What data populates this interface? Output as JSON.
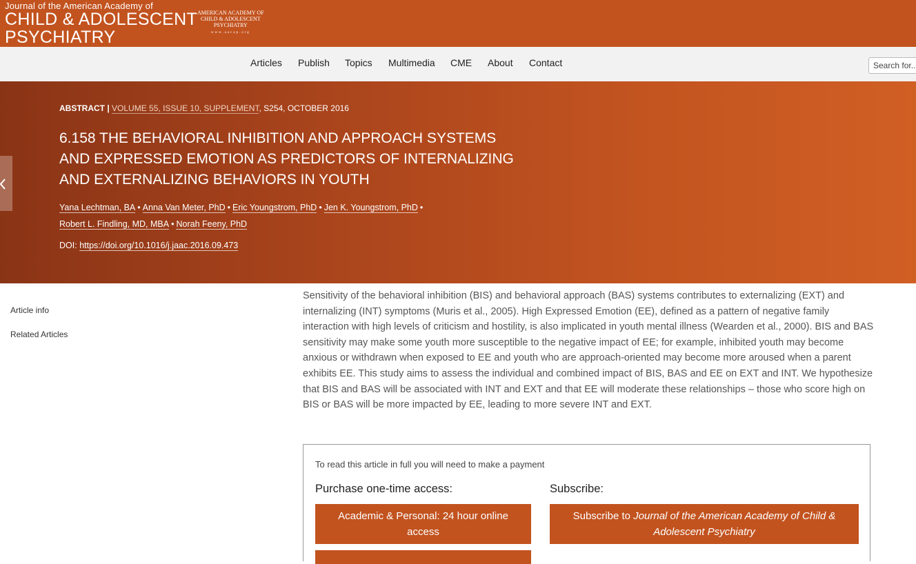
{
  "header": {
    "brand_line1": "Journal of the American Academy of",
    "brand_line2": "CHILD & ADOLESCENT",
    "brand_line3": "PSYCHIATRY",
    "seal_line1": "AMERICAN ACADEMY OF",
    "seal_line2": "CHILD & ADOLESCENT",
    "seal_line3": "PSYCHIATRY",
    "seal_line4": "www.aacap.org"
  },
  "nav": {
    "items": [
      "Articles",
      "Publish",
      "Topics",
      "Multimedia",
      "CME",
      "About",
      "Contact"
    ],
    "search_placeholder": "Search for..."
  },
  "article": {
    "type": "ABSTRACT",
    "separator": "|",
    "volume": "VOLUME 55, ISSUE 10, SUPPLEMENT",
    "pages_date": ", S254, OCTOBER 2016",
    "title": "6.158 THE BEHAVIORAL INHIBITION AND APPROACH SYSTEMS AND EXPRESSED EMOTION AS PREDICTORS OF INTERNALIZING AND EXTERNALIZING BEHAVIORS IN YOUTH",
    "authors": [
      "Yana Lechtman, BA",
      "Anna Van Meter, PhD",
      "Eric Youngstrom, PhD",
      "Jen K. Youngstrom, PhD",
      "Robert L. Findling, MD, MBA",
      "Norah Feeny, PhD"
    ],
    "author_sep": "•",
    "doi_label": "DOI:",
    "doi": "https://doi.org/10.1016/j.jaac.2016.09.473",
    "abstract": "Sensitivity of the behavioral inhibition (BIS) and behavioral approach (BAS) systems contributes to externalizing (EXT) and internalizing (INT) symptoms (Muris et al., 2005). High Expressed Emotion (EE), defined as a pattern of negative family interaction with high levels of criticism and hostility, is also implicated in youth mental illness (Wearden et al., 2000). BIS and BAS sensitivity may make some youth more susceptible to the negative impact of EE; for example, inhibited youth may become anxious or withdrawn when exposed to EE and youth who are approach-oriented may become more aroused when a parent exhibits EE. This study aims to assess the individual and combined impact of BIS, BAS and EE on EXT and INT. We hypothesize that BIS and BAS will be associated with INT and EXT and that EE will moderate these relationships – those who score high on BIS or BAS will be more impacted by EE, leading to more severe INT and EXT."
  },
  "sidebar": {
    "items": [
      "Article info",
      "Related Articles"
    ]
  },
  "paywall": {
    "note": "To read this article in full you will need to make a payment",
    "purchase_heading": "Purchase one-time access:",
    "subscribe_heading": "Subscribe:",
    "purchase_button": "Academic & Personal: 24 hour online access",
    "subscribe_prefix": "Subscribe to",
    "subscribe_journal": "Journal of the American Academy of Child & Adolescent Psychiatry"
  },
  "colors": {
    "brand": "#c2531f",
    "hero_start": "#8a3416",
    "hero_end": "#d05f24"
  }
}
